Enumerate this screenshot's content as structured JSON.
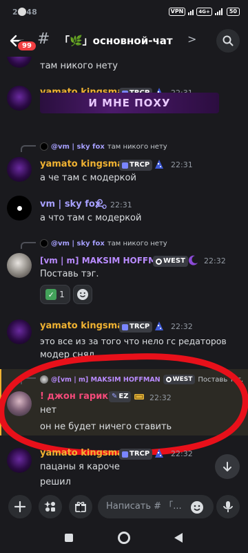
{
  "status": {
    "time": "22:48",
    "vpn": "VPN",
    "net": "4G+",
    "battery": "50"
  },
  "header": {
    "back_badge": "99",
    "channel_title": "「🌿」основной-чат",
    "chevron": ">"
  },
  "messages": {
    "m0": {
      "text": "там никого нету"
    },
    "m1": {
      "author": "yamato kingsman",
      "tag": "TRCP",
      "time": "22:31",
      "embed_text": "И МНЕ ПОХУ"
    },
    "m2": {
      "reply_author": "@vm | sky fox",
      "reply_text": "там никого нету",
      "author": "yamato kingsman",
      "tag": "TRCP",
      "time": "22:31",
      "text": "а че там с модеркой"
    },
    "m3": {
      "author": "vm | sky fox",
      "time": "22:31",
      "text": "а что там с модеркой"
    },
    "m4": {
      "reply_author": "@vm | sky fox",
      "reply_text": "там никого нету",
      "author": "[vm | m] MAKSIM HOFFMAN",
      "tag": "WEST",
      "time": "22:32",
      "text": "Поставь тэг.",
      "reaction_count": "1"
    },
    "m5": {
      "author": "yamato kingsman",
      "tag": "TRCP",
      "time": "22:32",
      "text1": "это все из за того что нело гс редаторов",
      "text2": "модер снял"
    },
    "m6": {
      "reply_author": "@[vm | m] MAKSIM HOFFMAN",
      "reply_tag": "WEST",
      "reply_text": "Поставь тэг.",
      "author": "! джон гарик))",
      "tag": "EZ",
      "time": "22:32",
      "text1": "нет",
      "text2": "он не будет ничего ставить"
    },
    "m7": {
      "author": "yamato kingsman",
      "tag": "TRCP",
      "time": "22:32",
      "text1": "пацаны я кароче",
      "text2": "решил"
    }
  },
  "composer": {
    "placeholder": "Написать # 「..."
  },
  "colors": {
    "yamato": "#f0b232",
    "skyfox": "#a7a0ff",
    "maksim": "#b98bff",
    "john": "#f44a7a",
    "highlight": "#f0b232"
  }
}
